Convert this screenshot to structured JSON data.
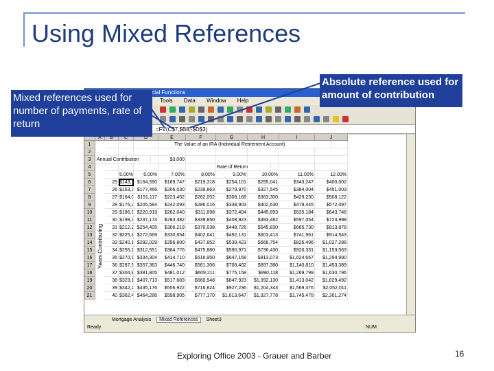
{
  "slide": {
    "title": "Using Mixed References",
    "footer": "Exploring Office 2003 - Grauer and Barber",
    "page_number": "16"
  },
  "callouts": {
    "left": "Mixed references used for number of payments, rate of return",
    "right": "Absolute reference used for amount of contribution"
  },
  "excel": {
    "window_title": "2003 - Advanced Financial Functions",
    "menus": [
      "Tools",
      "Data",
      "Window",
      "Help"
    ],
    "formula": "=FV(C$7,$B8,-$D$3)",
    "columns": [
      "A",
      "B",
      "C",
      "D",
      "E",
      "F",
      "G",
      "H",
      "I",
      "J"
    ],
    "sheet_title": "The Value of an IRA (Individual Retirement Account)",
    "contribution_label": "Annual Contribution",
    "contribution_value": "$3,000",
    "rate_header": "Rate of Return",
    "years_label": "Years Contributing",
    "rate_headers": [
      "5.00%",
      "6.00%",
      "7.00%",
      "8.00%",
      "9.00%",
      "10.00%",
      "11.00%",
      "12.00%"
    ],
    "rows": [
      {
        "num": "1",
        "year": "",
        "values": [
          "",
          "",
          "",
          "",
          "",
          "",
          "",
          ""
        ]
      },
      {
        "num": "2",
        "year": "",
        "values": [
          "",
          "",
          "",
          "",
          "",
          "",
          "",
          ""
        ]
      },
      {
        "num": "3",
        "year": "",
        "values": [
          "",
          "",
          "",
          "",
          "",
          "",
          "",
          ""
        ]
      },
      {
        "num": "4",
        "year": "",
        "values": [
          "",
          "",
          "",
          "",
          "",
          "",
          "",
          ""
        ]
      },
      {
        "num": "5",
        "year": "",
        "values": [
          "",
          "",
          "",
          "",
          "",
          "",
          "",
          ""
        ]
      },
      {
        "num": "6",
        "year": "25",
        "values": [
          "$143,181",
          "$164,590",
          "$189,747",
          "$219,318",
          "$254,101",
          "$295,041",
          "$343,247",
          "$400,002"
        ]
      },
      {
        "num": "7",
        "year": "26",
        "values": [
          "$153,340",
          "$177,466",
          "$206,030",
          "$239,863",
          "$279,970",
          "$327,545",
          "$384,004",
          "$451,003"
        ]
      },
      {
        "num": "8",
        "year": "27",
        "values": [
          "$164,007",
          "$191,117",
          "$223,452",
          "$262,052",
          "$308,168",
          "$363,300",
          "$429,230",
          "$508,122"
        ]
      },
      {
        "num": "9",
        "year": "28",
        "values": [
          "$175,208",
          "$205,584",
          "$242,093",
          "$286,016",
          "$338,903",
          "$402,630",
          "$479,445",
          "$572,097"
        ]
      },
      {
        "num": "10",
        "year": "29",
        "values": [
          "$186,968",
          "$220,919",
          "$262,040",
          "$311,898",
          "$372,404",
          "$445,893",
          "$535,184",
          "$643,748"
        ]
      },
      {
        "num": "11",
        "year": "30",
        "values": [
          "$199,317",
          "$237,174",
          "$283,382",
          "$339,850",
          "$408,923",
          "$493,482",
          "$597,054",
          "$723,998"
        ]
      },
      {
        "num": "12",
        "year": "31",
        "values": [
          "$212,282",
          "$254,405",
          "$306,219",
          "$370,038",
          "$448,726",
          "$545,830",
          "$665,730",
          "$813,878"
        ]
      },
      {
        "num": "13",
        "year": "32",
        "values": [
          "$225,896",
          "$272,669",
          "$330,654",
          "$402,641",
          "$492,131",
          "$603,413",
          "$741,961",
          "$914,543"
        ]
      },
      {
        "num": "14",
        "year": "33",
        "values": [
          "$240,191",
          "$292,029",
          "$356,800",
          "$437,852",
          "$539,423",
          "$666,754",
          "$826,496",
          "$1,027,288"
        ]
      },
      {
        "num": "15",
        "year": "34",
        "values": [
          "$255,200",
          "$312,551",
          "$384,776",
          "$475,880",
          "$590,971",
          "$736,430",
          "$920,331",
          "$1,153,563"
        ]
      },
      {
        "num": "16",
        "year": "35",
        "values": [
          "$270,960",
          "$334,304",
          "$414,710",
          "$516,950",
          "$647,158",
          "$813,073",
          "$1,024,667",
          "$1,294,990"
        ]
      },
      {
        "num": "17",
        "year": "36",
        "values": [
          "$287,508",
          "$357,363",
          "$446,740",
          "$561,306",
          "$708,402",
          "$897,380",
          "$1,140,810",
          "$1,453,389"
        ]
      },
      {
        "num": "18",
        "year": "37",
        "values": [
          "$304,884",
          "$381,805",
          "$481,012",
          "$609,211",
          "$775,158",
          "$990,118",
          "$1,269,799",
          "$1,630,796"
        ]
      },
      {
        "num": "19",
        "year": "38",
        "values": [
          "$323,129",
          "$407,713",
          "$517,683",
          "$660,948",
          "$847,923",
          "$1,092,130",
          "$1,413,042",
          "$1,829,492"
        ]
      },
      {
        "num": "20",
        "year": "39",
        "values": [
          "$342,285",
          "$435,176",
          "$556,922",
          "$716,824",
          "$927,236",
          "$1,204,343",
          "$1,569,376",
          "$2,052,011"
        ]
      },
      {
        "num": "21",
        "year": "40",
        "values": [
          "$362,400",
          "$464,286",
          "$598,905",
          "$777,170",
          "$1,013,647",
          "$1,327,778",
          "$1,745,478",
          "$2,301,274"
        ]
      }
    ],
    "sheet_tabs": [
      "Mortgage Analysis",
      "Mixed References",
      "Sheet3"
    ],
    "status": "Ready",
    "status_right": "NUM"
  }
}
